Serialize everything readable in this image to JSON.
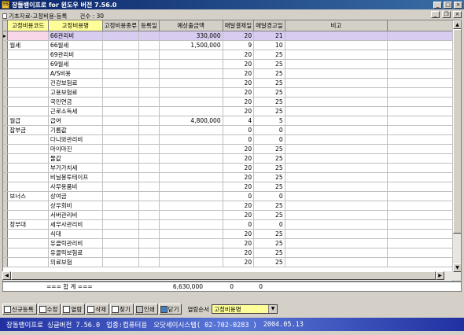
{
  "window": {
    "title": "장들뱅이프로 for 윈도우 버전 7.56.0",
    "app_icon": "Y6"
  },
  "subwindow": {
    "title": "기초자료-고정비용-등록",
    "count": "건수 : 30"
  },
  "grid": {
    "columns": [
      "고정비용코드",
      "고정비용명",
      "고정비용종류",
      "등록일",
      "예상출금액",
      "매달결제일",
      "매달경고일",
      "비고"
    ],
    "rows": [
      {
        "code": "",
        "name": "66관리비",
        "type": "",
        "date": "",
        "amount": "330,000",
        "pay_day": "20",
        "warn_day": "21",
        "note": ""
      },
      {
        "code": "월세",
        "name": "66월세",
        "type": "",
        "date": "",
        "amount": "1,500,000",
        "pay_day": "9",
        "warn_day": "10",
        "note": ""
      },
      {
        "code": "",
        "name": "69관리비",
        "type": "",
        "date": "",
        "amount": "",
        "pay_day": "20",
        "warn_day": "25",
        "note": ""
      },
      {
        "code": "",
        "name": "69월세",
        "type": "",
        "date": "",
        "amount": "",
        "pay_day": "20",
        "warn_day": "25",
        "note": ""
      },
      {
        "code": "",
        "name": "A/S비용",
        "type": "",
        "date": "",
        "amount": "",
        "pay_day": "20",
        "warn_day": "25",
        "note": ""
      },
      {
        "code": "",
        "name": "건강보험료",
        "type": "",
        "date": "",
        "amount": "",
        "pay_day": "20",
        "warn_day": "25",
        "note": ""
      },
      {
        "code": "",
        "name": "고용보험료",
        "type": "",
        "date": "",
        "amount": "",
        "pay_day": "20",
        "warn_day": "25",
        "note": ""
      },
      {
        "code": "",
        "name": "국민연금",
        "type": "",
        "date": "",
        "amount": "",
        "pay_day": "20",
        "warn_day": "25",
        "note": ""
      },
      {
        "code": "",
        "name": "근로소득세",
        "type": "",
        "date": "",
        "amount": "",
        "pay_day": "20",
        "warn_day": "25",
        "note": ""
      },
      {
        "code": "월급",
        "name": "급여",
        "type": "",
        "date": "",
        "amount": "4,800,000",
        "pay_day": "4",
        "warn_day": "5",
        "note": ""
      },
      {
        "code": "잡부금",
        "name": "기름값",
        "type": "",
        "date": "",
        "amount": "",
        "pay_day": "0",
        "warn_day": "0",
        "note": ""
      },
      {
        "code": "",
        "name": "다니와관리비",
        "type": "",
        "date": "",
        "amount": "",
        "pay_day": "0",
        "warn_day": "0",
        "note": ""
      },
      {
        "code": "",
        "name": "마이마진",
        "type": "",
        "date": "",
        "amount": "",
        "pay_day": "20",
        "warn_day": "25",
        "note": ""
      },
      {
        "code": "",
        "name": "물값",
        "type": "",
        "date": "",
        "amount": "",
        "pay_day": "20",
        "warn_day": "25",
        "note": ""
      },
      {
        "code": "",
        "name": "부가가치세",
        "type": "",
        "date": "",
        "amount": "",
        "pay_day": "20",
        "warn_day": "25",
        "note": ""
      },
      {
        "code": "",
        "name": "비닐봉투테이프",
        "type": "",
        "date": "",
        "amount": "",
        "pay_day": "20",
        "warn_day": "25",
        "note": ""
      },
      {
        "code": "",
        "name": "사무용품비",
        "type": "",
        "date": "",
        "amount": "",
        "pay_day": "20",
        "warn_day": "25",
        "note": ""
      },
      {
        "code": "보너스",
        "name": "상여금",
        "type": "",
        "date": "",
        "amount": "",
        "pay_day": "0",
        "warn_day": "0",
        "note": ""
      },
      {
        "code": "",
        "name": "상우회비",
        "type": "",
        "date": "",
        "amount": "",
        "pay_day": "20",
        "warn_day": "25",
        "note": ""
      },
      {
        "code": "",
        "name": "서버관리비",
        "type": "",
        "date": "",
        "amount": "",
        "pay_day": "20",
        "warn_day": "25",
        "note": ""
      },
      {
        "code": "장부대",
        "name": "세무사관리비",
        "type": "",
        "date": "",
        "amount": "",
        "pay_day": "0",
        "warn_day": "0",
        "note": ""
      },
      {
        "code": "",
        "name": "식대",
        "type": "",
        "date": "",
        "amount": "",
        "pay_day": "20",
        "warn_day": "25",
        "note": ""
      },
      {
        "code": "",
        "name": "유클릭관리비",
        "type": "",
        "date": "",
        "amount": "",
        "pay_day": "20",
        "warn_day": "25",
        "note": ""
      },
      {
        "code": "",
        "name": "유클릭보험료",
        "type": "",
        "date": "",
        "amount": "",
        "pay_day": "20",
        "warn_day": "25",
        "note": ""
      },
      {
        "code": "",
        "name": "의료보험",
        "type": "",
        "date": "",
        "amount": "",
        "pay_day": "20",
        "warn_day": "25",
        "note": ""
      }
    ],
    "selected_row": 0
  },
  "totals": {
    "label": "=== 합 계 ===",
    "amount": "6,630,000",
    "pay_day": "0",
    "warn_day": "0"
  },
  "toolbar": {
    "buttons": [
      {
        "label": "신규등록",
        "icon": "new-doc-icon",
        "color": "#ffffff"
      },
      {
        "label": "수정",
        "icon": "edit-icon",
        "color": "#ffffff"
      },
      {
        "label": "열람",
        "icon": "view-icon",
        "color": "#ffffff"
      },
      {
        "label": "삭제",
        "icon": "delete-icon",
        "color": "#ffffff"
      },
      {
        "label": "찾기",
        "icon": "find-icon",
        "color": "#ffffff"
      },
      {
        "label": "인쇄",
        "icon": "print-icon",
        "color": "#c0c0c0"
      },
      {
        "label": "닫기",
        "icon": "close-door-icon",
        "color": "#4080c0"
      }
    ],
    "sort_label": "열람순서",
    "sort_value": "고정비용명"
  },
  "statusbar": {
    "app": "장돌뱅이프로 싱글버전 7.56.0",
    "business": "업종:컴퓨터용",
    "vendor": "오닷세이시스템( 02-702-0283 )",
    "date": "2004.05.13"
  },
  "colors": {
    "title_bar": "#0a246a",
    "highlight_header": "#ffff99",
    "selected_row": "#d8ccf0",
    "statusbar": "#2030a0"
  }
}
